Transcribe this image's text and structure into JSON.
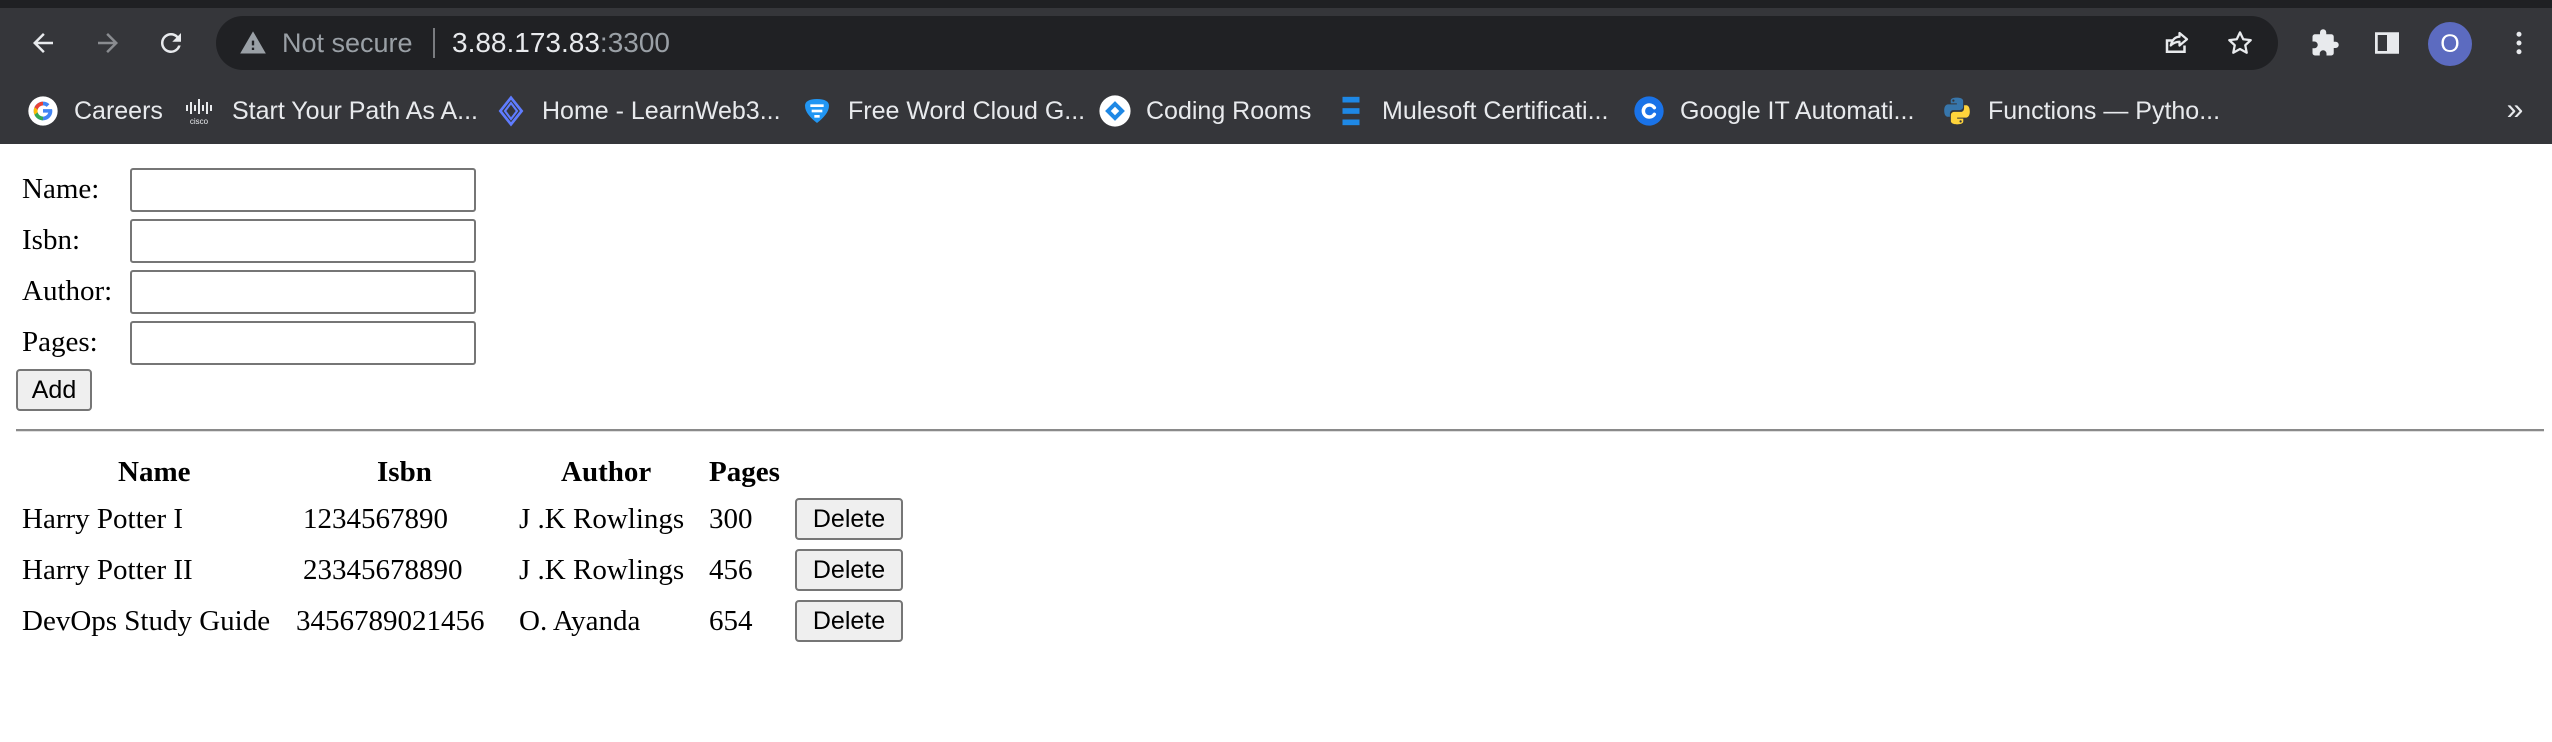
{
  "browser": {
    "security_label": "Not secure",
    "url_host": "3.88.173.83",
    "url_port": ":3300",
    "profile_initial": "O",
    "colors": {
      "frame": "#35363a",
      "omnibox": "#202124",
      "avatar": "#5c6bc0"
    },
    "icons": [
      "back-icon",
      "forward-icon",
      "reload-icon",
      "warning-icon",
      "share-icon",
      "star-icon",
      "extensions-icon",
      "side-panel-icon",
      "kebab-menu-icon"
    ]
  },
  "bookmarks": {
    "items": [
      {
        "label": "Careers",
        "icon": "google-icon"
      },
      {
        "label": "Start Your Path As A...",
        "icon": "cisco-icon"
      },
      {
        "label": "Home - LearnWeb3...",
        "icon": "learnweb3-icon"
      },
      {
        "label": "Free Word Cloud G...",
        "icon": "word-cloud-icon"
      },
      {
        "label": "Coding Rooms",
        "icon": "coding-rooms-icon"
      },
      {
        "label": "Mulesoft Certificati...",
        "icon": "mulesoft-icon"
      },
      {
        "label": "Google IT Automati...",
        "icon": "coursera-icon"
      },
      {
        "label": "Functions — Pytho...",
        "icon": "python-icon"
      }
    ],
    "more": "»"
  },
  "form": {
    "name_label": "Name:",
    "name_value": "",
    "isbn_label": "Isbn:",
    "isbn_value": "",
    "author_label": "Author:",
    "author_value": "",
    "pages_label": "Pages:",
    "pages_value": "",
    "add_label": "Add"
  },
  "table": {
    "headers": [
      "Name",
      "Isbn",
      "Author",
      "Pages"
    ],
    "rows": [
      {
        "name": "Harry Potter I",
        "isbn": "1234567890",
        "author": "J .K Rowlings",
        "pages": "300",
        "action": "Delete"
      },
      {
        "name": "Harry Potter II",
        "isbn": "23345678890",
        "author": "J .K Rowlings",
        "pages": "456",
        "action": "Delete"
      },
      {
        "name": "DevOps Study Guide",
        "isbn": "3456789021456",
        "author": "O. Ayanda",
        "pages": "654",
        "action": "Delete"
      }
    ]
  }
}
